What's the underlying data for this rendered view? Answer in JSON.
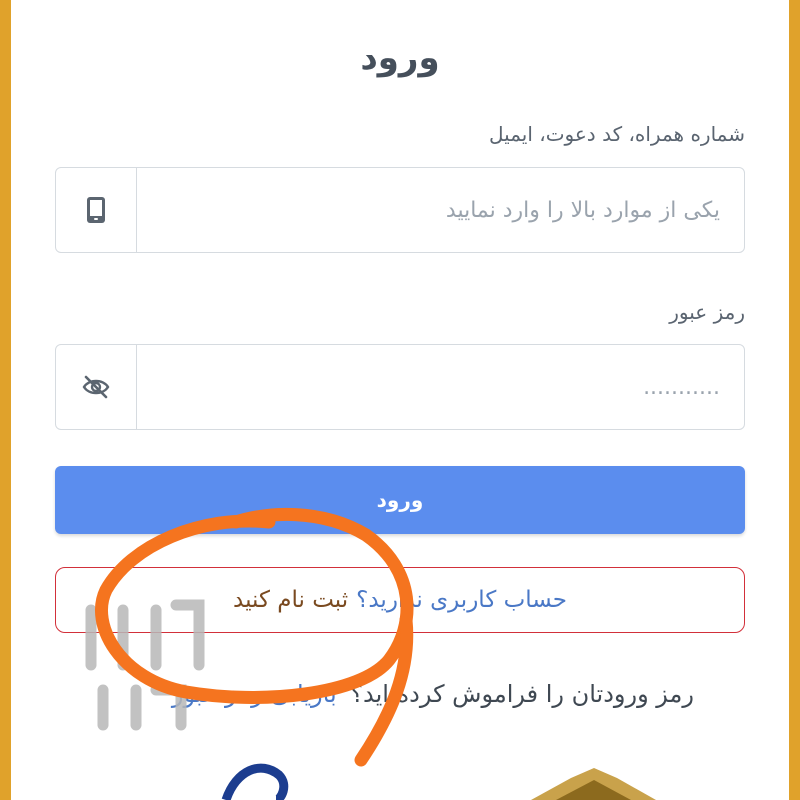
{
  "page": {
    "title": "ورود"
  },
  "identifier": {
    "label": "شماره همراه، کد دعوت، ایمیل",
    "placeholder": "یکی از موارد بالا را وارد نمایید",
    "icon": "mobile-phone-icon"
  },
  "password": {
    "label": "رمز عبور",
    "placeholder": "...........",
    "icon": "eye-slash-icon"
  },
  "login_button": {
    "label": "ورود",
    "color": "#5b8dee"
  },
  "signup": {
    "question": "حساب کاربری ندارید؟",
    "link": "ثبت نام کنید",
    "border_color": "#d2303a"
  },
  "forgot": {
    "text": "رمز ورودتان را فراموش کرده اید؟",
    "link": "بازیابی رمز عبور"
  },
  "watermark": {
    "text": "آسان مال"
  },
  "colors": {
    "frame": "#e0a22b",
    "annotation": "#f5741f"
  }
}
